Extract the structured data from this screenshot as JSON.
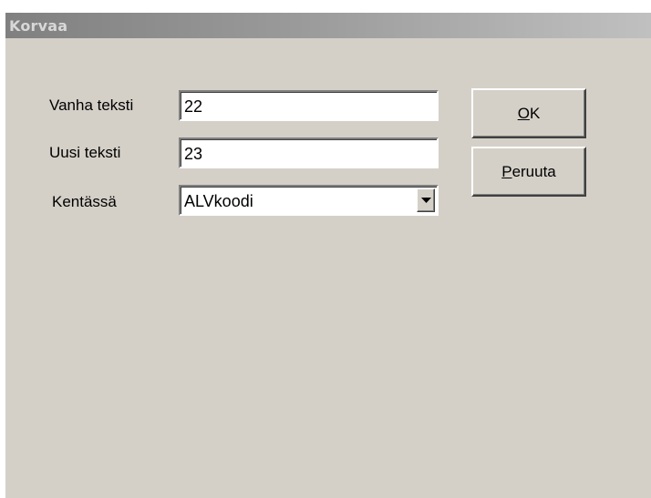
{
  "window": {
    "title": "Korvaa"
  },
  "form": {
    "old_text_label": "Vanha teksti",
    "old_text_value": "22",
    "new_text_label": "Uusi teksti",
    "new_text_value": "23",
    "field_label": "Kentässä",
    "field_selected": "ALVkoodi",
    "dropdown_icon": "chevron-down-icon"
  },
  "buttons": {
    "ok_accel": "O",
    "ok_rest": "K",
    "cancel_accel": "P",
    "cancel_rest": "eruuta"
  }
}
